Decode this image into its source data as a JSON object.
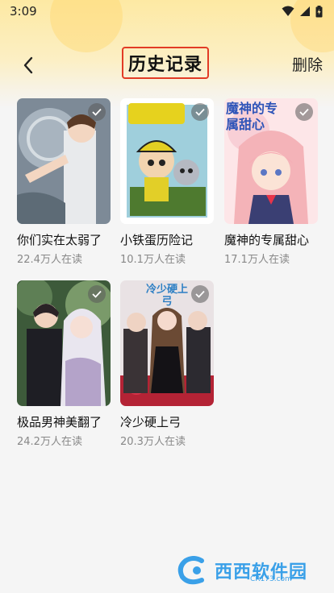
{
  "status_bar": {
    "time": "3:09"
  },
  "header": {
    "title": "历史记录",
    "delete_label": "删除"
  },
  "comics": [
    {
      "title": "你们实在太弱了",
      "readers": "22.4万人在读",
      "checked": true
    },
    {
      "title": "小铁蛋历险记",
      "readers": "10.1万人在读",
      "checked": true
    },
    {
      "title": "魔神的专属甜心",
      "readers": "17.1万人在读",
      "checked": true,
      "cover_text": "魔神的专属甜心"
    },
    {
      "title": "极品男神美翻了",
      "readers": "24.2万人在读",
      "checked": true
    },
    {
      "title": "冷少硬上弓",
      "readers": "20.3万人在读",
      "checked": true,
      "cover_text": "冷少硬上弓"
    }
  ],
  "watermark": {
    "brand": "西西软件园",
    "site": "CR173.com"
  },
  "icons": [
    "back-arrow-icon",
    "wifi-icon",
    "signal-icon",
    "battery-icon",
    "check-icon"
  ],
  "colors": {
    "title_border": "#e23b26",
    "header_bg": "#fde9a3",
    "subtext": "#888888"
  }
}
